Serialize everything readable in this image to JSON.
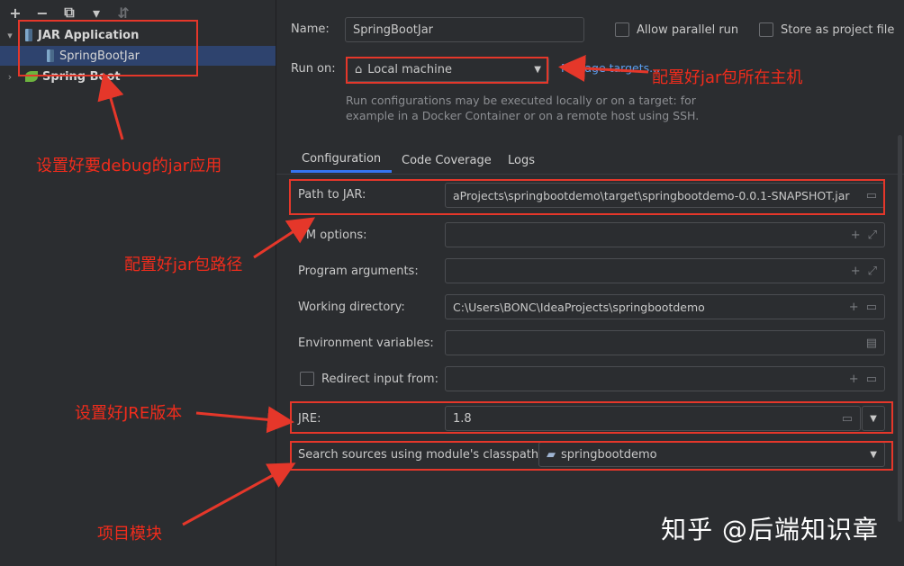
{
  "sidebar": {
    "toolbar": [
      "+",
      "−",
      "⧉",
      "▾",
      "⇵"
    ],
    "tree": {
      "group": "JAR Application",
      "child": "SpringBootJar",
      "group2": "Spring Boot"
    }
  },
  "form": {
    "name_label": "Name:",
    "name_value": "SpringBootJar",
    "allow_parallel": "Allow parallel run",
    "store_project": "Store as project file",
    "run_on_label": "Run on:",
    "run_on_value": "Local machine",
    "manage_targets": "Manage targets...",
    "description": "Run configurations may be executed locally or on a target: for example in a Docker Container or on a remote host using SSH.",
    "tabs": [
      "Configuration",
      "Code Coverage",
      "Logs"
    ],
    "path_label": "Path to JAR:",
    "path_value": "aProjects\\springbootdemo\\target\\springbootdemo-0.0.1-SNAPSHOT.jar",
    "vm_label": "VM options:",
    "vm_value": "",
    "args_label": "Program arguments:",
    "args_value": "",
    "workdir_label": "Working directory:",
    "workdir_value": "C:\\Users\\BONC\\IdeaProjects\\springbootdemo",
    "env_label": "Environment variables:",
    "env_value": "",
    "redirect_label": "Redirect input from:",
    "redirect_value": "",
    "jre_label": "JRE:",
    "jre_value": "1.8",
    "module_label": "Search sources using module's classpath:",
    "module_value": "springbootdemo"
  },
  "annotations": {
    "a1": "设置好要debug的jar应用",
    "a2": "配置好jar包所在主机",
    "a3": "配置好jar包路径",
    "a4": "设置好JRE版本",
    "a5": "项目模块"
  },
  "watermark": "知乎 @后端知识章",
  "colors": {
    "annotation": "#e5372a",
    "selection": "#2e436e",
    "accent": "#3574f0"
  }
}
